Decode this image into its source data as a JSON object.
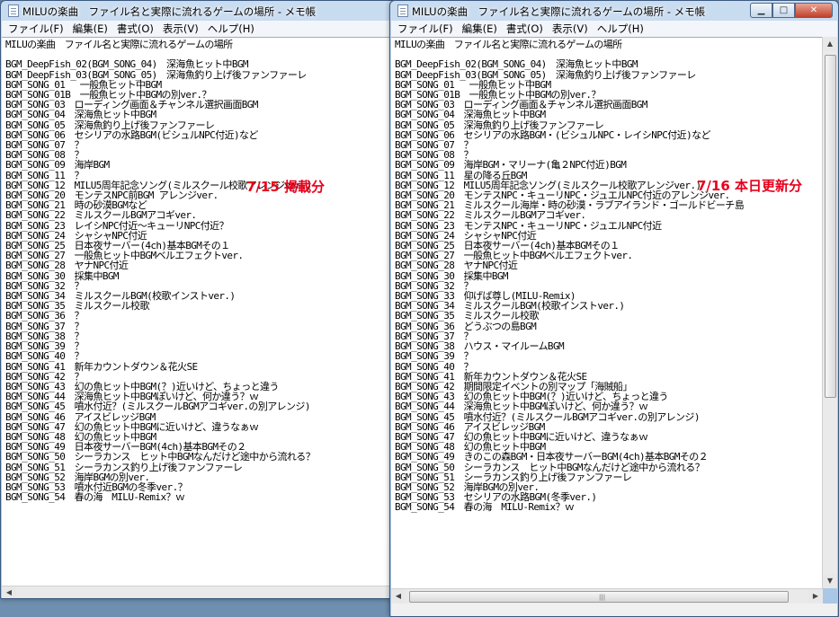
{
  "windows": [
    {
      "title": "MILUの楽曲　ファイル名と実際に流れるゲームの場所 - メモ帳",
      "menu": [
        "ファイル(F)",
        "編集(E)",
        "書式(O)",
        "表示(V)",
        "ヘルプ(H)"
      ],
      "note": "7/15 掲載分",
      "note_color": "#e8001c",
      "lines": [
        "MILUの楽曲　ファイル名と実際に流れるゲームの場所",
        "",
        "BGM_DeepFish_02(BGM_SONG_04)　深海魚ヒット中BGM",
        "BGM_DeepFish_03(BGM_SONG_05)　深海魚釣り上げ後ファンファーレ",
        "BGM_SONG_01　 一般魚ヒット中BGM",
        "BGM_SONG_01B　一般魚ヒット中BGMの別ver.？",
        "BGM_SONG_03　ローディング画面＆チャンネル選択画面BGM",
        "BGM_SONG_04　深海魚ヒット中BGM",
        "BGM_SONG_05　深海魚釣り上げ後ファンファーレ",
        "BGM_SONG_06　セシリアの水路BGM(ビシュルNPC付近)など",
        "BGM_SONG_07　？",
        "BGM_SONG_08　？",
        "BGM_SONG_09　海岸BGM",
        "BGM_SONG_11　？",
        "BGM_SONG_12　MILU5周年記念ソング(ミルスクール校歌アレンジver.)",
        "BGM_SONG_20　モンテスNPC前BGM アレンジver.",
        "BGM_SONG_21　時の砂漠BGMなど",
        "BGM_SONG_22　ミルスクールBGMアコギver.",
        "BGM_SONG_23　レイシNPC付近～キューリNPC付近？",
        "BGM_SONG_24　シャシャNPC付近",
        "BGM_SONG_25　日本夜サーバー(4ch)基本BGMその１",
        "BGM_SONG_27　一般魚ヒット中BGMベルエフェクトver.",
        "BGM_SONG_28　ヤナNPC付近",
        "BGM_SONG_30　採集中BGM",
        "BGM_SONG_32　？",
        "BGM_SONG_34　ミルスクールBGM(校歌インストver.)",
        "BGM_SONG_35　ミルスクール校歌",
        "BGM_SONG_36　？",
        "BGM_SONG_37　？",
        "BGM_SONG_38　？",
        "BGM_SONG_39　？",
        "BGM_SONG_40　？",
        "BGM_SONG_41　新年カウントダウン＆花火SE",
        "BGM_SONG_42　？",
        "BGM_SONG_43　幻の魚ヒット中BGM(？)近いけど、ちょっと違う",
        "BGM_SONG_44　深海魚ヒット中BGMぽいけど、何か違う？ｗ",
        "BGM_SONG_45　噴水付近？(ミルスクールBGMアコギver.の別アレンジ)",
        "BGM_SONG_46　アイスビレッジBGM",
        "BGM_SONG_47　幻の魚ヒット中BGMに近いけど、違うなぁｗ",
        "BGM_SONG_48　幻の魚ヒット中BGM",
        "BGM_SONG_49　日本夜サーバーBGM(4ch)基本BGMその２",
        "BGM_SONG_50　シーラカンス　ヒット中BGMなんだけど途中から流れる？",
        "BGM_SONG_51　シーラカンス釣り上げ後ファンファーレ",
        "BGM_SONG_52　海岸BGMの別ver.",
        "BGM_SONG_53　噴水付近BGMの冬季ver.？",
        "BGM_SONG_54　春の海　MILU-Remix？ｗ"
      ]
    },
    {
      "title": "MILUの楽曲　ファイル名と実際に流れるゲームの場所 - メモ帳",
      "menu": [
        "ファイル(F)",
        "編集(E)",
        "書式(O)",
        "表示(V)",
        "ヘルプ(H)"
      ],
      "note": "7/16 本日更新分",
      "note_color": "#e8001c",
      "lines": [
        "MILUの楽曲　ファイル名と実際に流れるゲームの場所",
        "",
        "BGM_DeepFish_02(BGM_SONG_04)　深海魚ヒット中BGM",
        "BGM_DeepFish_03(BGM_SONG_05)　深海魚釣り上げ後ファンファーレ",
        "BGM_SONG_01　 一般魚ヒット中BGM",
        "BGM_SONG_01B　一般魚ヒット中BGMの別ver.？",
        "BGM_SONG_03　ローディング画面＆チャンネル選択画面BGM",
        "BGM_SONG_04　深海魚ヒット中BGM",
        "BGM_SONG_05　深海魚釣り上げ後ファンファーレ",
        "BGM_SONG_06　セシリアの水路BGM・(ビシュルNPC・レイシNPC付近)など",
        "BGM_SONG_07　？",
        "BGM_SONG_08　？",
        "BGM_SONG_09　海岸BGM・マリーナ(亀２NPC付近)BGM",
        "BGM_SONG_11　星の降る丘BGM",
        "BGM_SONG_12　MILU5周年記念ソング(ミルスクール校歌アレンジver.)",
        "BGM_SONG_20　モンテスNPC・キューリNPC・ジュエルNPC付近のアレンジver.",
        "BGM_SONG_21　ミルスクール海岸・時の砂漠・ラブアイランド・ゴールドビーチ島",
        "BGM_SONG_22　ミルスクールBGMアコギver.",
        "BGM_SONG_23　モンテスNPC・キューリNPC・ジュエルNPC付近",
        "BGM_SONG_24　シャシャNPC付近",
        "BGM_SONG_25　日本夜サーバー(4ch)基本BGMその１",
        "BGM_SONG_27　一般魚ヒット中BGMベルエフェクトver.",
        "BGM_SONG_28　ヤナNPC付近",
        "BGM_SONG_30　採集中BGM",
        "BGM_SONG_32　？",
        "BGM_SONG_33　仰げば尊し(MILU-Remix)",
        "BGM_SONG_34　ミルスクールBGM(校歌インストver.)",
        "BGM_SONG_35　ミルスクール校歌",
        "BGM_SONG_36　どうぶつの島BGM",
        "BGM_SONG_37　？",
        "BGM_SONG_38　ハウス・マイルームBGM",
        "BGM_SONG_39　？",
        "BGM_SONG_40　？",
        "BGM_SONG_41　新年カウントダウン＆花火SE",
        "BGM_SONG_42　期間限定イベントの別マップ「海賊船」",
        "BGM_SONG_43　幻の魚ヒット中BGM(？)近いけど、ちょっと違う",
        "BGM_SONG_44　深海魚ヒット中BGMぽいけど、何か違う？ｗ",
        "BGM_SONG_45　噴水付近？(ミルスクールBGMアコギver.の別アレンジ)",
        "BGM_SONG_46　アイスビレッジBGM",
        "BGM_SONG_47　幻の魚ヒット中BGMに近いけど、違うなぁｗ",
        "BGM_SONG_48　幻の魚ヒット中BGM",
        "BGM_SONG_49　きのこの森BGM・日本夜サーバーBGM(4ch)基本BGMその２",
        "BGM_SONG_50　シーラカンス　ヒット中BGMなんだけど途中から流れる？",
        "BGM_SONG_51　シーラカンス釣り上げ後ファンファーレ",
        "BGM_SONG_52　海岸BGMの別ver.",
        "BGM_SONG_53　セシリアの水路BGM(冬季ver.)",
        "BGM_SONG_54　春の海　MILU-Remix？ｗ"
      ]
    }
  ]
}
